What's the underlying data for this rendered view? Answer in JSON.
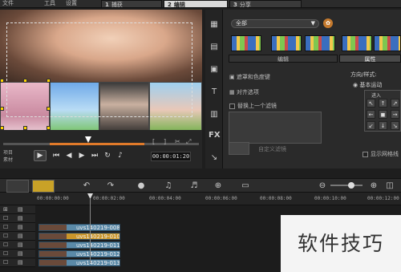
{
  "menu": {
    "file": "文件",
    "tools": "工具",
    "settings": "设置"
  },
  "steps": [
    {
      "num": "1",
      "label": "捕获"
    },
    {
      "num": "2",
      "label": "编辑"
    },
    {
      "num": "3",
      "label": "分享"
    }
  ],
  "player": {
    "mode_project": "项目",
    "mode_clip": "素材",
    "timecode": "00:00:01:20"
  },
  "library": {
    "filter_selected": "全部",
    "tabs": [
      "编辑",
      "属性"
    ],
    "options": {
      "crop_zoom": "遮罩和色度键",
      "align": "对齐选项",
      "replace_last_filter": "替换上一个滤镜",
      "custom_filter": "自定义滤镜",
      "direction_style": "方向/样式:",
      "basic_motion": "基本运动",
      "grid_label": "进入",
      "show_grid": "显示网格线"
    }
  },
  "timeline": {
    "ruler_ticks": [
      "00:00:00:00",
      "00:00:02:00",
      "00:00:04:00",
      "00:00:06:00",
      "00:00:08:00",
      "00:00:10:00",
      "00:00:12:00"
    ],
    "clips": [
      "uvs140219-008",
      "uvs140219-010",
      "uvs140219-011",
      "uvs140219-012",
      "uvs140219-013"
    ]
  },
  "watermark": "软件技巧"
}
